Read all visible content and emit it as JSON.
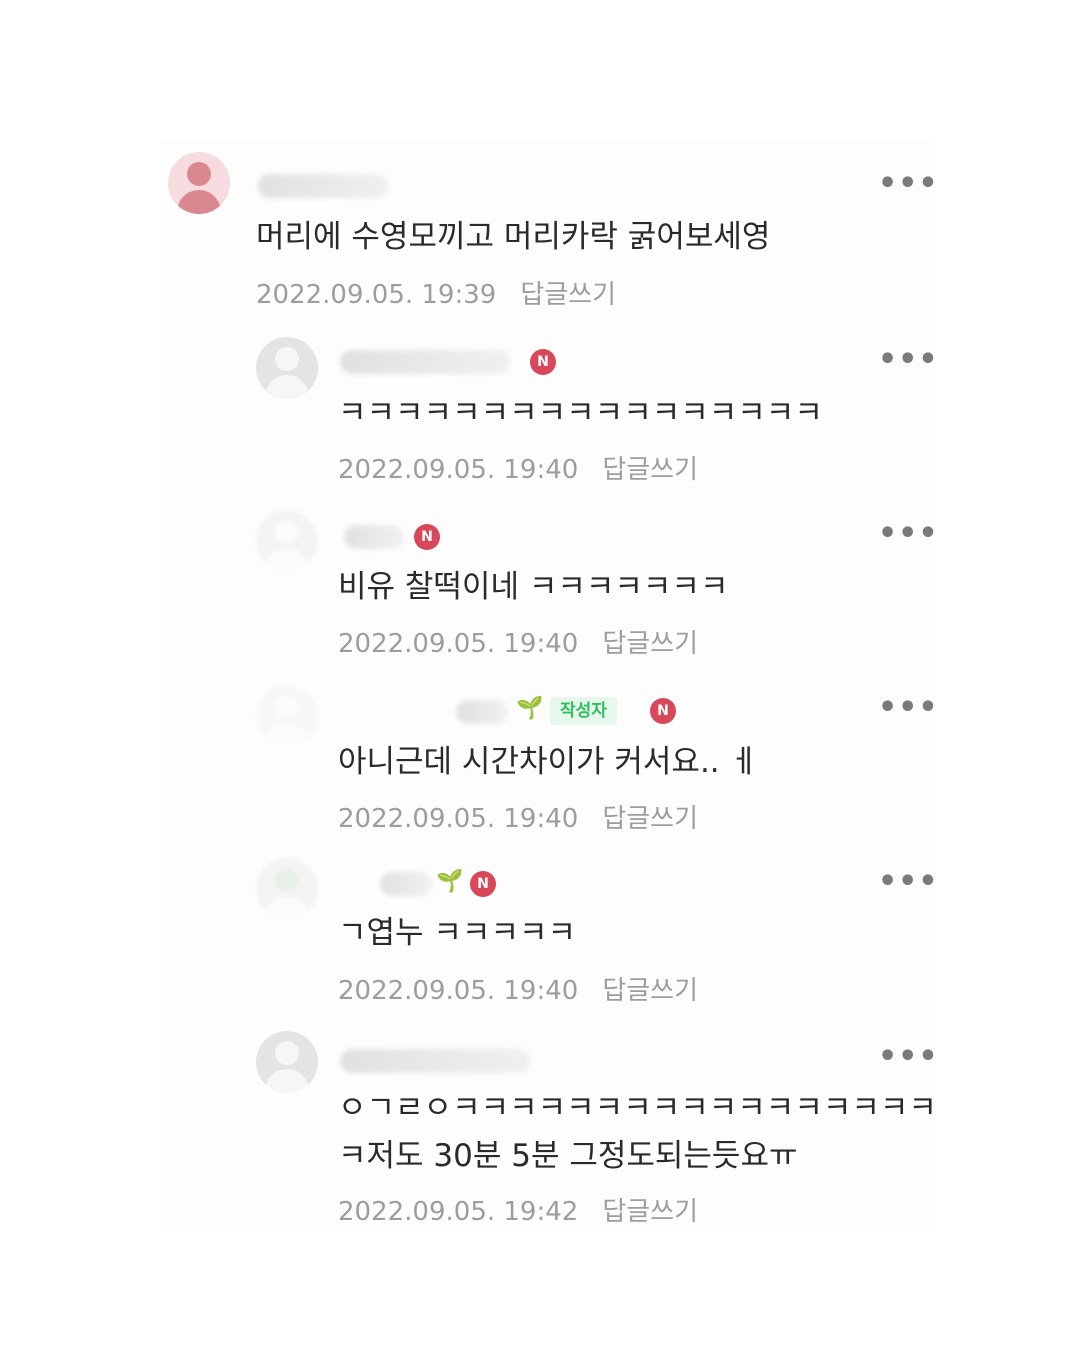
{
  "comments": [
    {
      "text": "머리에 수영모끼고 머리카락 굵어보세영",
      "date": "2022.09.05. 19:39",
      "reply": "답글쓰기",
      "more": "•••"
    },
    {
      "text": "ㅋㅋㅋㅋㅋㅋㅋㅋㅋㅋㅋㅋㅋㅋㅋㅋㅋ",
      "date": "2022.09.05. 19:40",
      "reply": "답글쓰기",
      "more": "•••",
      "badge": "N"
    },
    {
      "text": "비유 찰떡이네 ㅋㅋㅋㅋㅋㅋㅋ",
      "date": "2022.09.05. 19:40",
      "reply": "답글쓰기",
      "more": "•••",
      "badge": "N"
    },
    {
      "text": "아니근데 시간차이가 커서요.. ㅔ",
      "date": "2022.09.05. 19:40",
      "reply": "답글쓰기",
      "more": "•••",
      "badge": "N",
      "author_badge": "작성자"
    },
    {
      "text": "ㄱ엽누 ㅋㅋㅋㅋㅋ",
      "date": "2022.09.05. 19:40",
      "reply": "답글쓰기",
      "more": "•••",
      "badge": "N"
    },
    {
      "text_line1": "ㅇㄱㄹㅇㅋㅋㅋㅋㅋㅋㅋㅋㅋㅋㅋㅋㅋㅋㅋㅋㅋ",
      "text_line2": "ㅋ저도 30분 5분 그정도되는듯요ㅠ",
      "date": "2022.09.05. 19:42",
      "reply": "답글쓰기",
      "more": "•••"
    }
  ],
  "icons": {
    "new_badge_color": "#d8485a",
    "author_badge_color": "#2ebe5d",
    "sprout_icon": "sprout-icon"
  }
}
